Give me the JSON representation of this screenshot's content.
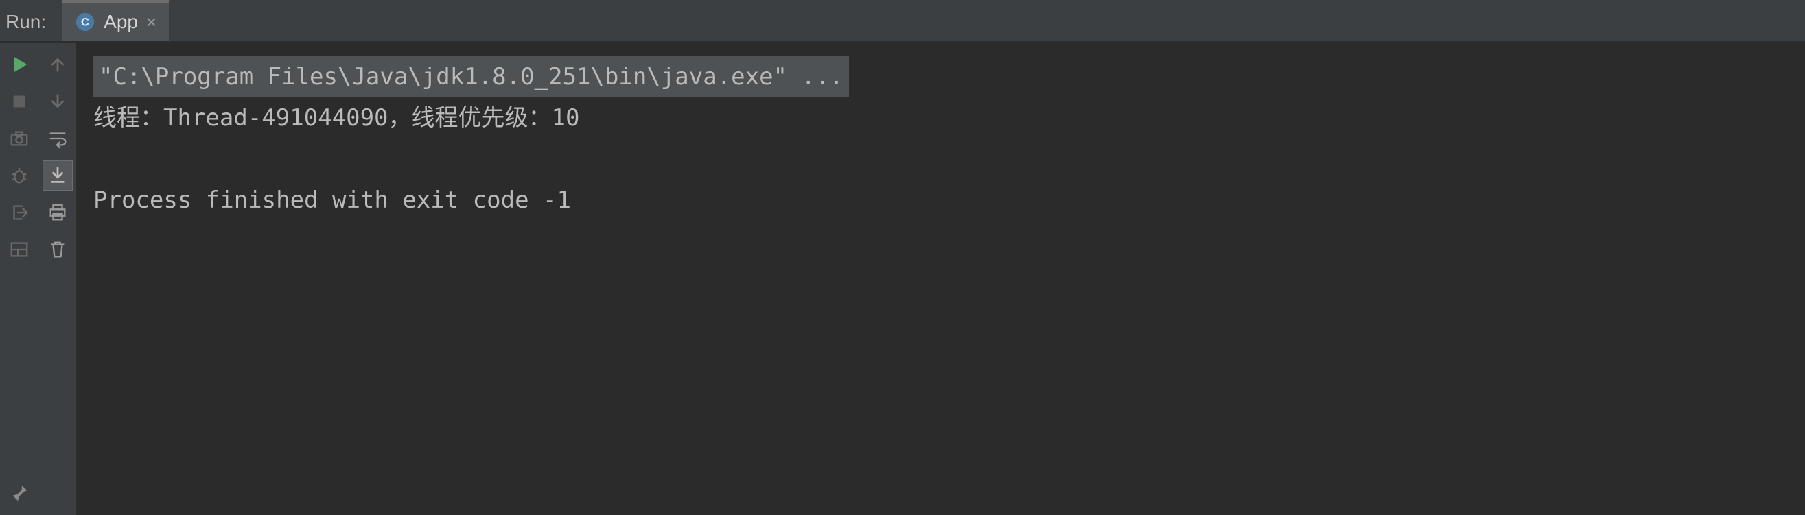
{
  "header": {
    "run_label": "Run:",
    "tab": {
      "icon": "class-icon",
      "label": "App",
      "close": "×"
    }
  },
  "toolbars": {
    "left": [
      {
        "name": "rerun-button",
        "icon": "play",
        "style": "run",
        "interact": true
      },
      {
        "name": "stop-button",
        "icon": "stop",
        "style": "dim",
        "interact": true
      },
      {
        "name": "dump-button",
        "icon": "camera",
        "style": "dim",
        "interact": true
      },
      {
        "name": "debug-button",
        "icon": "bug",
        "style": "dim",
        "interact": true
      },
      {
        "name": "exit-button",
        "icon": "exit",
        "style": "dim",
        "interact": true
      },
      {
        "name": "layout-button",
        "icon": "layout",
        "style": "dim",
        "interact": true
      },
      {
        "name": "pin-button",
        "icon": "pin",
        "style": "dim",
        "interact": true,
        "end": true
      }
    ],
    "right": [
      {
        "name": "up-button",
        "icon": "arrow-up",
        "style": "dim",
        "interact": true
      },
      {
        "name": "down-button",
        "icon": "arrow-down",
        "style": "dim",
        "interact": true
      },
      {
        "name": "soft-wrap-button",
        "icon": "wrap",
        "style": "",
        "interact": true
      },
      {
        "name": "scroll-end-button",
        "icon": "scroll-end",
        "style": "selected",
        "interact": true
      },
      {
        "name": "print-button",
        "icon": "print",
        "style": "",
        "interact": true
      },
      {
        "name": "clear-button",
        "icon": "trash",
        "style": "",
        "interact": true
      }
    ]
  },
  "console": {
    "command": "\"C:\\Program Files\\Java\\jdk1.8.0_251\\bin\\java.exe\" ...",
    "line1": "线程：Thread-491044090，线程优先级：10",
    "blank": "",
    "line2": "Process finished with exit code -1"
  }
}
